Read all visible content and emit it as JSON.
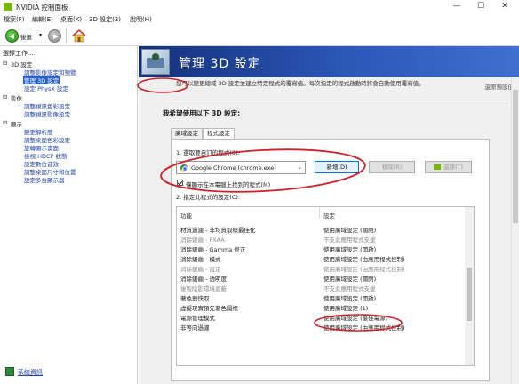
{
  "window": {
    "title": "NVIDIA 控制面板",
    "min_label": "—",
    "max_label": "☐",
    "close_label": "✕"
  },
  "menu": [
    "檔案(F)",
    "編輯(E)",
    "桌面(K)",
    "3D 設定(3)",
    "說明(H)"
  ],
  "toolbar": {
    "back_label": "後退",
    "dropdown": "▾"
  },
  "sidebar": {
    "header": "選擇工作...",
    "tree": [
      {
        "label": "3D 設定",
        "level": 0,
        "expander": "⊟"
      },
      {
        "label": "調整影像設定和預覽",
        "level": 1
      },
      {
        "label": "管理 3D 設定",
        "level": 1,
        "selected": true
      },
      {
        "label": "設定 PhysX 設定",
        "level": 1
      },
      {
        "label": "影像",
        "level": 0,
        "expander": "⊟"
      },
      {
        "label": "調整視訊色彩設定",
        "level": 1
      },
      {
        "label": "調整視訊影像設定",
        "level": 1
      },
      {
        "label": "顯示",
        "level": 0,
        "expander": "⊟"
      },
      {
        "label": "變更解析度",
        "level": 1
      },
      {
        "label": "調整桌面色彩設定",
        "level": 1
      },
      {
        "label": "旋轉顯示畫面",
        "level": 1
      },
      {
        "label": "檢視 HDCP 狀態",
        "level": 1
      },
      {
        "label": "設定數位音效",
        "level": 1
      },
      {
        "label": "調整桌面尺寸和位置",
        "level": 1
      },
      {
        "label": "設定多台顯示器",
        "level": 1
      }
    ],
    "system_info": "系統資訊"
  },
  "main": {
    "title": "管理 3D 設定",
    "restore_defaults": "還原預設值",
    "description": "您可以變更總域 3D 設定並建立特定程式的覆寫值。每次指定的程式啟動時將會自動使用覆寫值。",
    "preference_heading": "我希望使用以下 3D 設定:",
    "tabs": [
      {
        "label": "廣域設定",
        "active": false
      },
      {
        "label": "程式設定",
        "active": true
      }
    ],
    "step1_label": "1. 選取要自訂的程式(0):",
    "program_selected": "Google Chrome (chrome.exe)",
    "buttons": {
      "add": "新增(D)",
      "remove": "移除(R)",
      "restore": "還原(T)"
    },
    "only_show_found": "僅顯示在本電腦上找到的程式(M)",
    "step2_label": "2. 指定此程式的設定(C):",
    "columns": [
      "功能",
      "設定"
    ],
    "rows": [
      {
        "feature": "材質過濾 - 非均質取樣最佳化",
        "setting": "使用廣域設定 (關閉)",
        "dim": false
      },
      {
        "feature": "消除鋸齒 - FXAA",
        "setting": "不支此應用程式支援",
        "dim": true
      },
      {
        "feature": "消除鋸齒 - Gamma 修正",
        "setting": "使用廣域設定 (開啟)",
        "dim": false
      },
      {
        "feature": "消除鋸齒 - 模式",
        "setting": "使用廣域設定 (由應用程式控制)",
        "dim": false
      },
      {
        "feature": "消除鋸齒 - 設定",
        "setting": "使用廣域設定 (由應用程式控制)",
        "dim": true
      },
      {
        "feature": "消除鋸齒 - 透明度",
        "setting": "使用廣域設定 (關閉)",
        "dim": false
      },
      {
        "feature": "後製陰影環境遮蔽",
        "setting": "不支此應用程式支援",
        "dim": true
      },
      {
        "feature": "著色器快取",
        "setting": "使用廣域設定 (開啟)",
        "dim": false
      },
      {
        "feature": "虛擬現實預先著色圖框",
        "setting": "使用廣域設定 (1)",
        "dim": false
      },
      {
        "feature": "電源管理模式",
        "setting": "使用廣域設定 (最佳電源)",
        "dim": false
      },
      {
        "feature": "非等向過濾",
        "setting": "使用廣域設定 (由應用程式控制)",
        "dim": false
      }
    ]
  },
  "colors": {
    "annotation": "#d0202a",
    "banner": "#2c58b8",
    "nvidia_green": "#76b900",
    "selection": "#2a62c9"
  }
}
